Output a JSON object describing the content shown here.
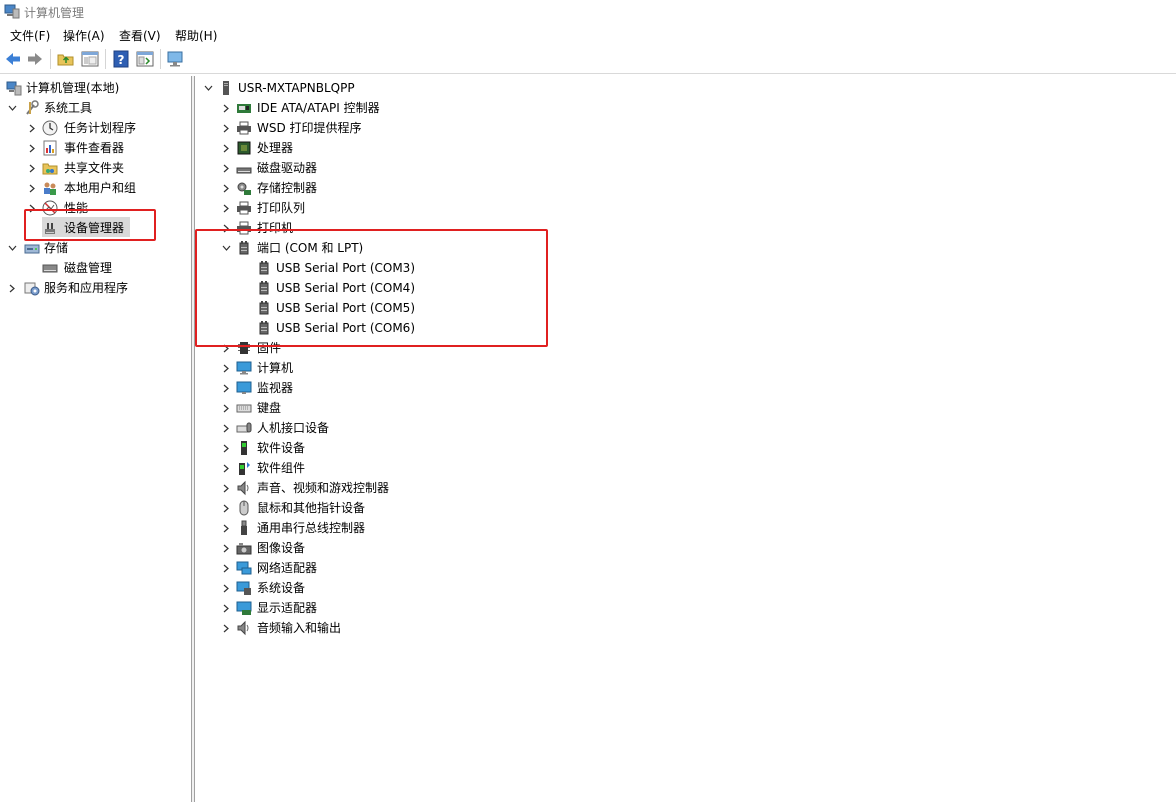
{
  "window": {
    "title": "计算机管理"
  },
  "menu": [
    "文件(F)",
    "操作(A)",
    "查看(V)",
    "帮助(H)"
  ],
  "toolbar": {
    "buttons": [
      "back-icon",
      "forward-icon",
      "up-folder-icon",
      "show-hide-tree-icon",
      "help-icon",
      "properties-icon",
      "monitor-icon"
    ]
  },
  "tree": {
    "root": "计算机管理(本地)",
    "system_tools": "系统工具",
    "items": [
      "任务计划程序",
      "事件查看器",
      "共享文件夹",
      "本地用户和组",
      "性能",
      "设备管理器"
    ],
    "storage": "存储",
    "disk_management": "磁盘管理",
    "services": "服务和应用程序"
  },
  "devices": {
    "computer_name": "USR-MXTAPNBLQPP",
    "categories_top": [
      "IDE ATA/ATAPI 控制器",
      "WSD 打印提供程序",
      "处理器",
      "磁盘驱动器",
      "存储控制器",
      "打印队列",
      "打印机"
    ],
    "ports_label": "端口 (COM 和 LPT)",
    "ports": [
      "USB Serial Port (COM3)",
      "USB Serial Port (COM4)",
      "USB Serial Port (COM5)",
      "USB Serial Port (COM6)"
    ],
    "categories_bottom": [
      "固件",
      "计算机",
      "监视器",
      "键盘",
      "人机接口设备",
      "软件设备",
      "软件组件",
      "声音、视频和游戏控制器",
      "鼠标和其他指针设备",
      "通用串行总线控制器",
      "图像设备",
      "网络适配器",
      "系统设备",
      "显示适配器",
      "音频输入和输出"
    ]
  },
  "colors": {
    "highlight": "#e02020",
    "selected": "#d9d9d9"
  }
}
